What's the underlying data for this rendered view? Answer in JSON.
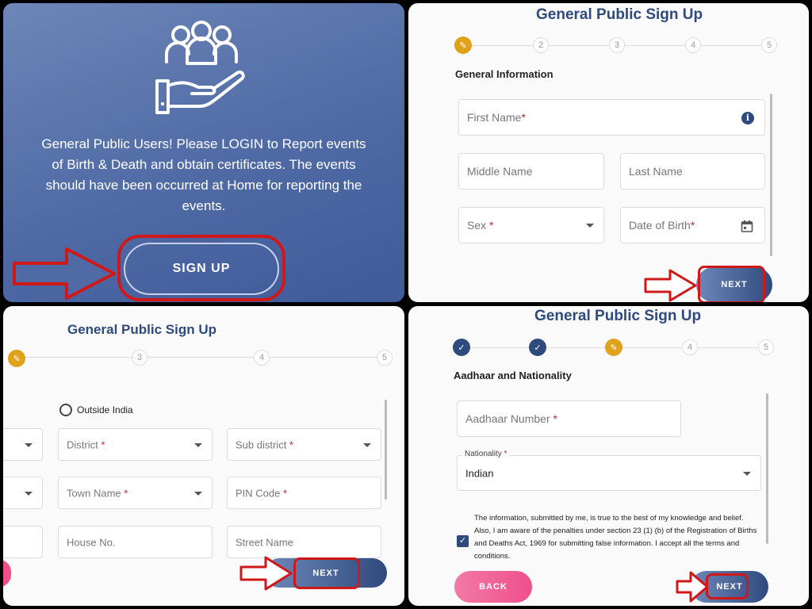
{
  "p1": {
    "message": "General Public Users! Please LOGIN to Report events of Birth & Death and obtain certificates. The events should have been occurred at Home for reporting the events.",
    "signup_label": "SIGN UP",
    "icon": "users-hand-icon"
  },
  "p2": {
    "title": "General Public Sign Up",
    "steps": [
      "2",
      "3",
      "4",
      "5"
    ],
    "section": "General Information",
    "first_name": "First Name",
    "middle_name": "Middle Name",
    "last_name": "Last Name",
    "sex": "Sex ",
    "dob": "Date of Birth",
    "req": "*",
    "next": "NEXT"
  },
  "p3": {
    "title": "General Public Sign Up",
    "steps": [
      "3",
      "4",
      "5"
    ],
    "outside_india": "Outside India",
    "district": "District ",
    "sub_district": "Sub district ",
    "town_name": "Town Name ",
    "pin_code": "PIN Code ",
    "house_no": "House No.",
    "street_name": "Street Name",
    "req": "*",
    "next": "NEXT"
  },
  "p4": {
    "title": "General Public Sign Up",
    "steps": [
      "4",
      "5"
    ],
    "section": "Aadhaar and Nationality",
    "aadhaar": "Aadhaar Number ",
    "nationality_label": "Nationality ",
    "nationality_value": "Indian",
    "req": "*",
    "declaration": "The information, submitted by me, is true to the best of my knowledge and belief. Also, I am aware of the penalties under section 23 (1) (b) of the Registration of Births and Deaths Act, 1969 for submitting false information. I accept all the terms and conditions.",
    "back": "BACK",
    "next": "NEXT"
  },
  "colors": {
    "primary": "#2f4a7c",
    "accent": "#e0a11b",
    "annotation": "#d01818",
    "back": "#f04f8a"
  }
}
